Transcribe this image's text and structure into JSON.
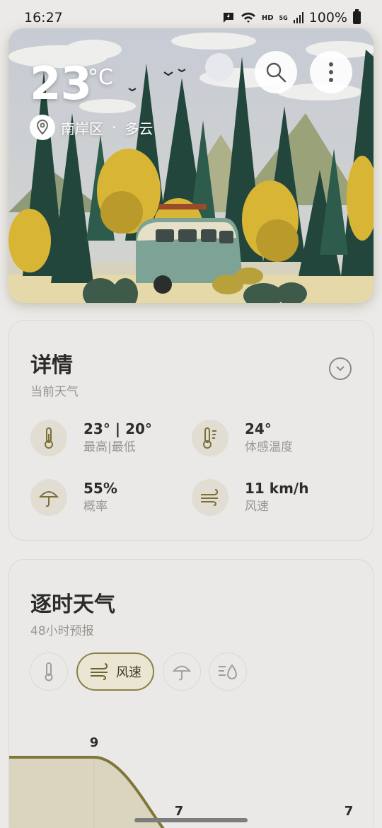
{
  "status_bar": {
    "time": "16:27",
    "network_label": "HD",
    "signal_label": "5G",
    "battery": "100%"
  },
  "hero": {
    "temperature": "23",
    "unit": "°C",
    "location": "南岸区",
    "separator": "·",
    "condition": "多云"
  },
  "details": {
    "title": "详情",
    "subtitle": "当前天气",
    "items": [
      {
        "value": "23° | 20°",
        "label": "最高|最低",
        "icon": "thermometer-icon"
      },
      {
        "value": "24°",
        "label": "体感温度",
        "icon": "feels-like-icon"
      },
      {
        "value": "55%",
        "label": "概率",
        "icon": "umbrella-icon"
      },
      {
        "value": "11 km/h",
        "label": "风速",
        "icon": "wind-icon"
      }
    ]
  },
  "hourly": {
    "title": "逐时天气",
    "subtitle": "48小时预报",
    "active_chip_label": "风速",
    "chips": [
      "temperature",
      "wind",
      "precipitation",
      "humidity"
    ]
  },
  "chart_data": {
    "type": "area",
    "series": [
      {
        "values": [
          9,
          7,
          7
        ]
      }
    ],
    "data_labels": [
      "9",
      "7",
      "7"
    ],
    "accent_color": "#7d7838",
    "fill_color": "#dbd5c0"
  },
  "colors": {
    "accent": "#8a8246",
    "card_bg": "#ebe9e7",
    "icon_bg": "#e1ddd2"
  }
}
